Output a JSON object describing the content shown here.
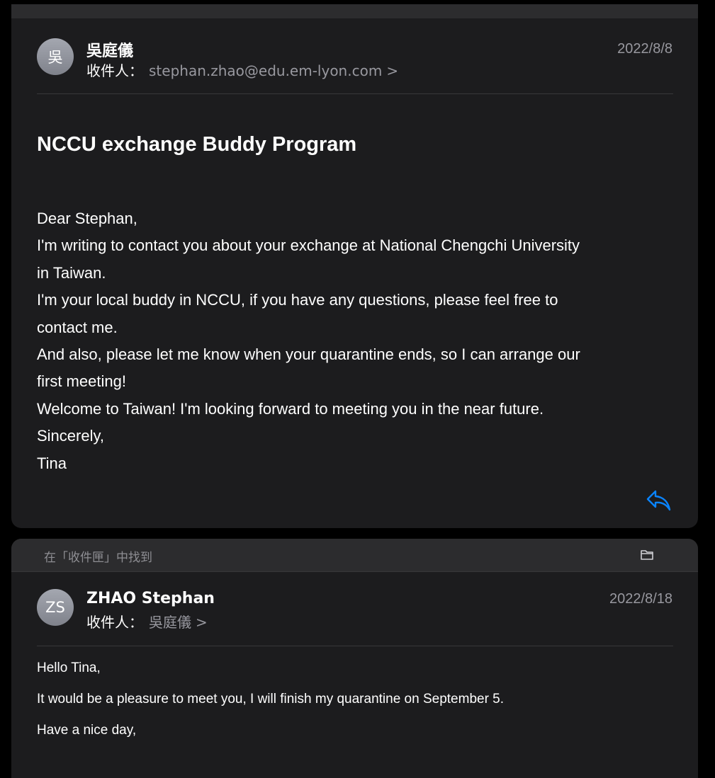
{
  "email_1": {
    "avatar_initials": "吳",
    "sender": "吳庭儀",
    "recipient_label": "收件人：",
    "recipient": "stephan.zhao@edu.em-lyon.com",
    "chevron": ">",
    "date": "2022/8/8",
    "subject": "NCCU exchange Buddy Program",
    "body_lines": [
      "Dear Stephan,",
      "I'm writing to contact you about your exchange at National Chengchi University",
      "in Taiwan.",
      "I'm your local buddy in NCCU, if you have any questions, please feel free to",
      "contact me.",
      "And also, please let me know when your quarantine ends, so I can arrange our",
      "first meeting!",
      "Welcome to Taiwan! I'm looking forward to meeting you in the near future.",
      "Sincerely,",
      "Tina"
    ],
    "reply_icon": "reply-icon"
  },
  "email_2": {
    "found_label": "在「收件匣」中找到",
    "folder_icon": "folder-icon",
    "avatar_initials": "ZS",
    "sender": "ZHAO Stephan",
    "recipient_label": "收件人：",
    "recipient": "吳庭儀",
    "chevron": ">",
    "date": "2022/8/18",
    "body_paragraphs": [
      "Hello Tina,",
      "It would be a pleasure to meet you, I will finish my quarantine on September 5.",
      "Have a nice day,"
    ]
  },
  "colors": {
    "background": "#000000",
    "card": "#1c1c1e",
    "secondary_text": "#98989f",
    "accent": "#0a84ff"
  }
}
